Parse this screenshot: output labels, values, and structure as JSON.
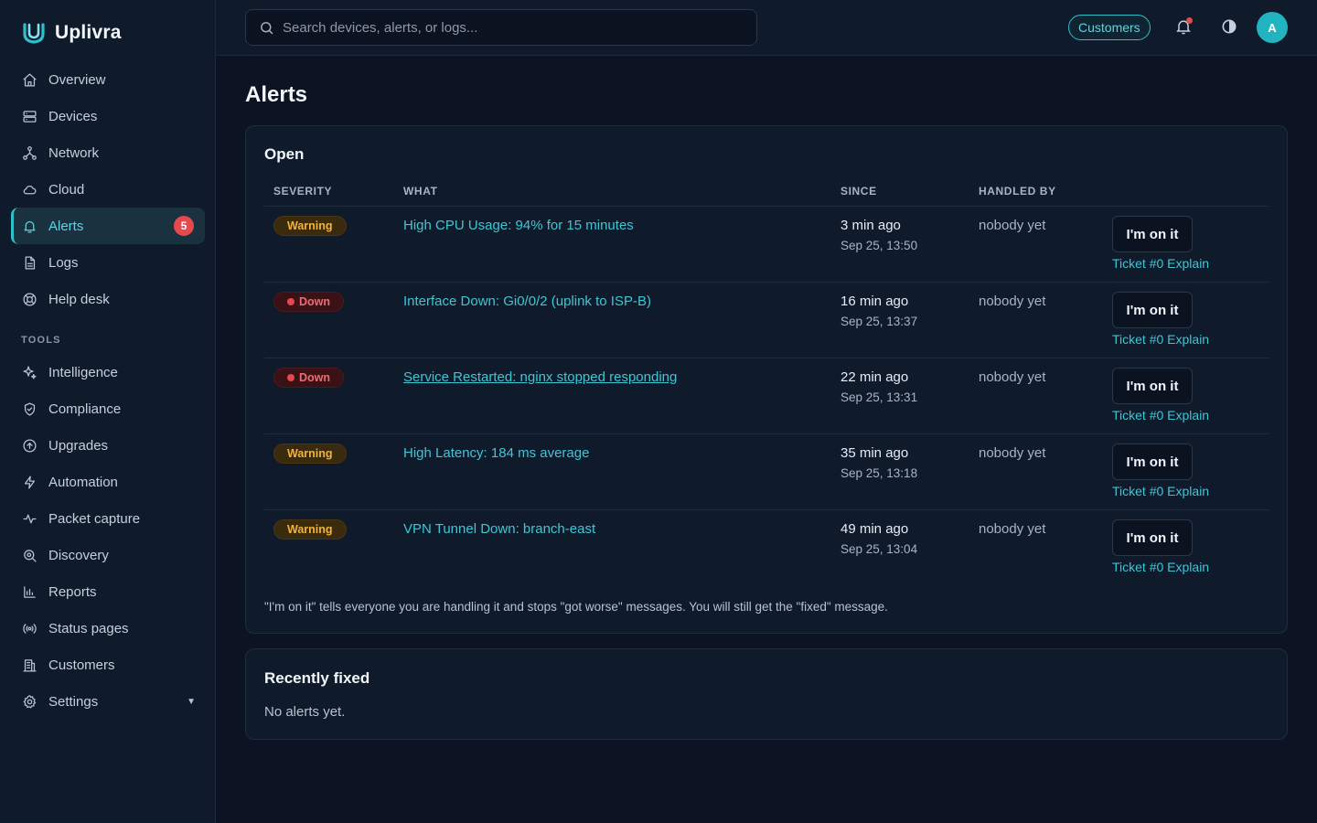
{
  "brand": {
    "name": "Uplivra"
  },
  "sidebar": {
    "items": [
      {
        "label": "Overview",
        "icon": "home-icon"
      },
      {
        "label": "Devices",
        "icon": "server-icon"
      },
      {
        "label": "Network",
        "icon": "network-icon"
      },
      {
        "label": "Cloud",
        "icon": "cloud-icon"
      },
      {
        "label": "Alerts",
        "icon": "bell-icon",
        "badge": "5",
        "active": true
      },
      {
        "label": "Logs",
        "icon": "file-icon"
      },
      {
        "label": "Help desk",
        "icon": "lifebuoy-icon"
      }
    ],
    "tools_heading": "TOOLS",
    "tools": [
      {
        "label": "Intelligence",
        "icon": "sparkle-icon"
      },
      {
        "label": "Compliance",
        "icon": "shield-check-icon"
      },
      {
        "label": "Upgrades",
        "icon": "arrow-up-circle-icon"
      },
      {
        "label": "Automation",
        "icon": "bolt-icon"
      },
      {
        "label": "Packet capture",
        "icon": "activity-icon"
      },
      {
        "label": "Discovery",
        "icon": "search-scan-icon"
      },
      {
        "label": "Reports",
        "icon": "bar-chart-icon"
      },
      {
        "label": "Status pages",
        "icon": "broadcast-icon"
      },
      {
        "label": "Customers",
        "icon": "building-icon"
      },
      {
        "label": "Settings",
        "icon": "gear-icon"
      }
    ]
  },
  "topbar": {
    "search_placeholder": "Search devices, alerts, or logs...",
    "customers_label": "Customers",
    "avatar_initial": "A"
  },
  "page": {
    "title": "Alerts"
  },
  "open": {
    "title": "Open",
    "columns": [
      "SEVERITY",
      "WHAT",
      "SINCE",
      "HANDLED BY"
    ],
    "rows": [
      {
        "severity": "Warning",
        "kind": "warning",
        "what": "High CPU Usage: 94% for 15 minutes",
        "since": "3 min ago",
        "date": "Sep 25, 13:50",
        "handled": "nobody yet",
        "action": "I'm on it",
        "ticket": "Ticket #0",
        "explain": "Explain"
      },
      {
        "severity": "Down",
        "kind": "down",
        "what": "Interface Down: Gi0/0/2 (uplink to ISP-B)",
        "since": "16 min ago",
        "date": "Sep 25, 13:37",
        "handled": "nobody yet",
        "action": "I'm on it",
        "ticket": "Ticket #0",
        "explain": "Explain"
      },
      {
        "severity": "Down",
        "kind": "down",
        "what": "Service Restarted: nginx stopped responding",
        "since": "22 min ago",
        "date": "Sep 25, 13:31",
        "handled": "nobody yet",
        "action": "I'm on it",
        "ticket": "Ticket #0",
        "explain": "Explain"
      },
      {
        "severity": "Warning",
        "kind": "warning",
        "what": "High Latency: 184 ms average",
        "since": "35 min ago",
        "date": "Sep 25, 13:18",
        "handled": "nobody yet",
        "action": "I'm on it",
        "ticket": "Ticket #0",
        "explain": "Explain"
      },
      {
        "severity": "Warning",
        "kind": "warning",
        "what": "VPN Tunnel Down: branch-east",
        "since": "49 min ago",
        "date": "Sep 25, 13:04",
        "handled": "nobody yet",
        "action": "I'm on it",
        "ticket": "Ticket #0",
        "explain": "Explain"
      }
    ],
    "footnote": "\"I'm on it\" tells everyone you are handling it and stops \"got worse\" messages. You will still get the \"fixed\" message."
  },
  "fixed": {
    "title": "Recently fixed",
    "empty": "No alerts yet."
  },
  "colors": {
    "accent": "#2fbfcc",
    "warning": "#f2b33d",
    "down": "#e5484d",
    "background": "#0c1322"
  }
}
